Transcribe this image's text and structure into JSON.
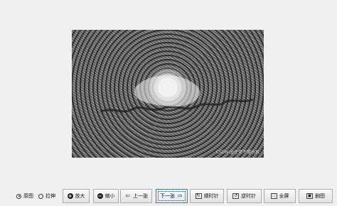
{
  "view_mode": {
    "options": [
      "原图",
      "拉伸"
    ],
    "selected": "原图"
  },
  "image": {
    "watermark": "CSDN @任佬不擅长机"
  },
  "toolbar": {
    "zoom_in_label": "放大",
    "zoom_out_label": "缩小",
    "prev_label": "上一张",
    "next_label": "下一张",
    "rotate_cw_label": "顺时针",
    "rotate_ccw_label": "逆时针",
    "fullscreen_label": "全屏",
    "last_label": "删图"
  },
  "icons": {
    "zoom_in": "plus-circle-icon",
    "zoom_out": "minus-circle-icon",
    "prev": "arrow-left-icon",
    "next": "arrow-right-icon",
    "rotate_cw": "rotate-cw-icon",
    "rotate_ccw": "rotate-ccw-icon",
    "fullscreen": "fullscreen-icon",
    "last": "image-icon"
  },
  "colors": {
    "active_button_border": "#3c7fb1"
  }
}
